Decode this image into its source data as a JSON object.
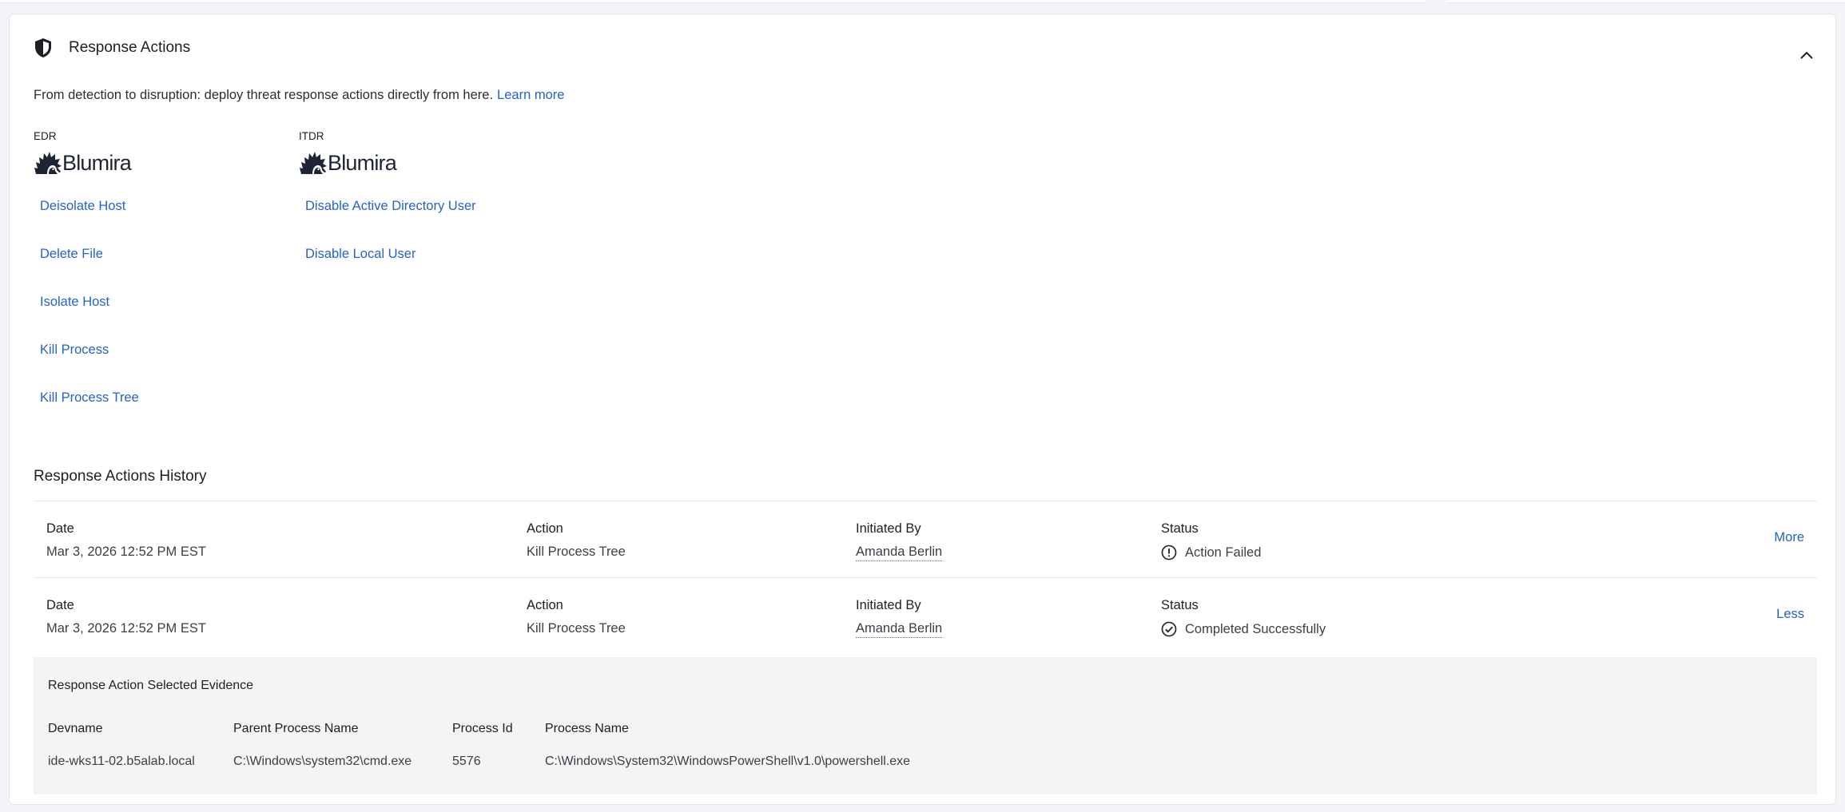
{
  "panel": {
    "title": "Response Actions",
    "intro": "From detection to disruption: deploy threat response actions directly from here.",
    "learn_more": "Learn more"
  },
  "vendors": [
    {
      "label": "EDR",
      "logo_text": "Blumira",
      "actions": [
        "Deisolate Host",
        "Delete File",
        "Isolate Host",
        "Kill Process",
        "Kill Process Tree"
      ]
    },
    {
      "label": "ITDR",
      "logo_text": "Blumira",
      "actions": [
        "Disable Active Directory User",
        "Disable Local User"
      ]
    }
  ],
  "history": {
    "title": "Response Actions History",
    "columns": {
      "date": "Date",
      "action": "Action",
      "initiated_by": "Initiated By",
      "status": "Status"
    },
    "rows": [
      {
        "date": "Mar 3, 2026 12:52 PM EST",
        "action": "Kill Process Tree",
        "initiated_by": "Amanda Berlin",
        "status": "Action Failed",
        "status_icon": "alert-circle-icon",
        "toggle": "More"
      },
      {
        "date": "Mar 3, 2026 12:52 PM EST",
        "action": "Kill Process Tree",
        "initiated_by": "Amanda Berlin",
        "status": "Completed Successfully",
        "status_icon": "check-circle-icon",
        "toggle": "Less"
      }
    ]
  },
  "evidence": {
    "title": "Response Action Selected Evidence",
    "columns": [
      "Devname",
      "Parent Process Name",
      "Process Id",
      "Process Name"
    ],
    "values": [
      "ide-wks11-02.b5alab.local",
      "C:\\Windows\\system32\\cmd.exe",
      "5576",
      "C:\\Windows\\System32\\WindowsPowerShell\\v1.0\\powershell.exe"
    ]
  },
  "colors": {
    "link": "#2563c9",
    "evidence_bg": "#f4f4f5",
    "border": "#e6e8ec"
  }
}
